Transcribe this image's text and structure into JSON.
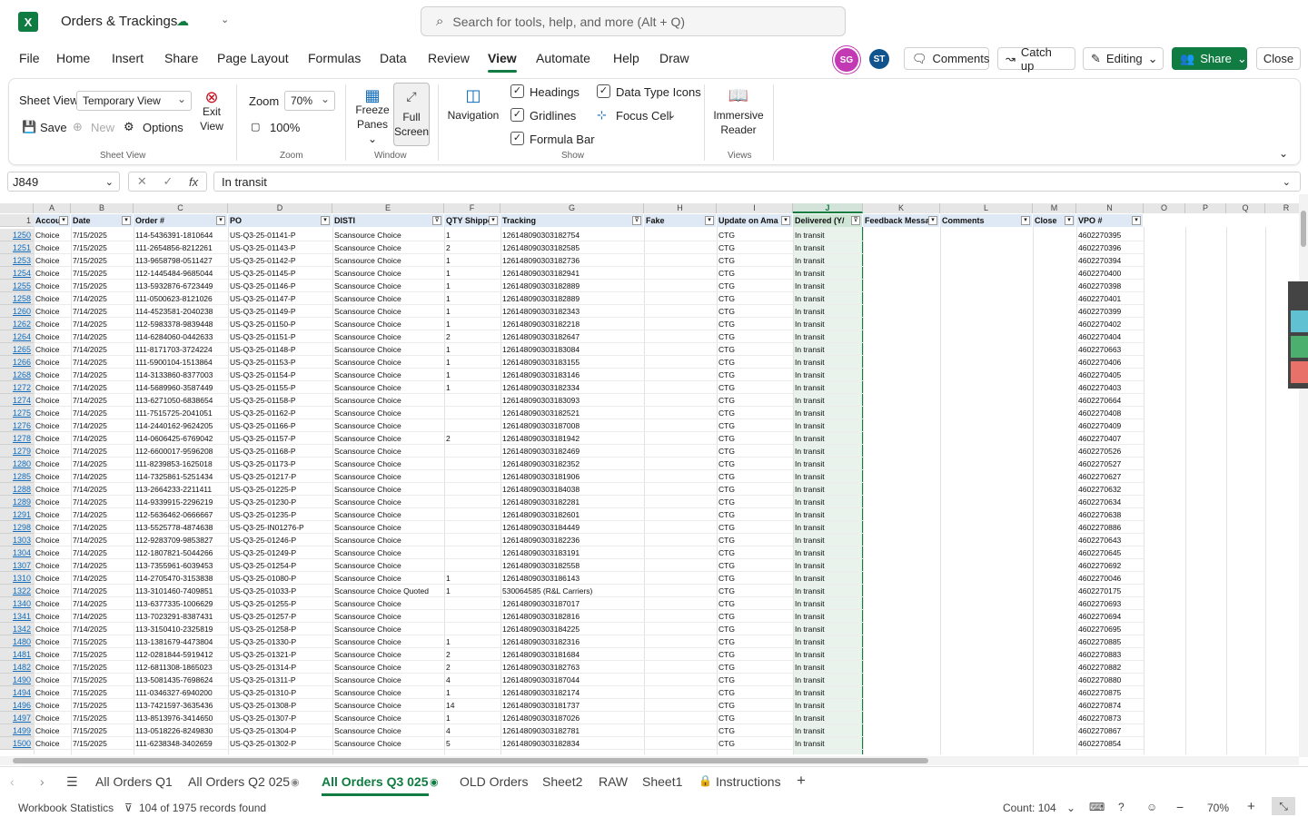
{
  "app": {
    "title": "Orders & Trackings",
    "logo_letter": "X"
  },
  "search": {
    "placeholder": "Search for tools, help, and more (Alt + Q)"
  },
  "menu": [
    "File",
    "Home",
    "Insert",
    "Share",
    "Page Layout",
    "Formulas",
    "Data",
    "Review",
    "View",
    "Automate",
    "Help",
    "Draw"
  ],
  "menu_active": "View",
  "users": [
    {
      "initials": "SG",
      "color": "#c239b3"
    },
    {
      "initials": "ST",
      "color": "#0f548c"
    }
  ],
  "buttons": {
    "comments": "Comments",
    "catchup": "Catch up",
    "editing": "Editing",
    "share": "Share",
    "close": "Close"
  },
  "ribbon": {
    "sheet_view_label": "Sheet View",
    "sheet_view_value": "Temporary View",
    "save": "Save",
    "new": "New",
    "options": "Options",
    "exit_view": "Exit\nView",
    "group_sheet_view": "Sheet View",
    "zoom_label": "Zoom",
    "zoom_value": "70%",
    "zoom_100": "100%",
    "group_zoom": "Zoom",
    "freeze_panes": "Freeze Panes",
    "full_screen": "Full Screen",
    "group_window": "Window",
    "navigation": "Navigation",
    "headings": "Headings",
    "gridlines": "Gridlines",
    "formula_bar": "Formula Bar",
    "data_type_icons": "Data Type Icons",
    "focus_cell": "Focus Cell",
    "group_show": "Show",
    "immersive_reader": "Immersive Reader",
    "group_views": "Views"
  },
  "formula": {
    "cell_ref": "J849",
    "value": "In transit"
  },
  "columns": [
    {
      "letter": "A",
      "header": "Accou"
    },
    {
      "letter": "B",
      "header": "Date"
    },
    {
      "letter": "C",
      "header": "Order #"
    },
    {
      "letter": "D",
      "header": "PO"
    },
    {
      "letter": "E",
      "header": "DISTI"
    },
    {
      "letter": "F",
      "header": "QTY Shippe"
    },
    {
      "letter": "G",
      "header": "Tracking"
    },
    {
      "letter": "H",
      "header": "Fake"
    },
    {
      "letter": "I",
      "header": "Update on Ama"
    },
    {
      "letter": "J",
      "header": "Delivered (Y/"
    },
    {
      "letter": "K",
      "header": "Feedback Messa"
    },
    {
      "letter": "L",
      "header": "Comments"
    },
    {
      "letter": "M",
      "header": "Close"
    },
    {
      "letter": "N",
      "header": "VPO #"
    },
    {
      "letter": "O",
      "header": ""
    },
    {
      "letter": "P",
      "header": ""
    },
    {
      "letter": "Q",
      "header": ""
    },
    {
      "letter": "R",
      "header": ""
    }
  ],
  "header_row_number": "1",
  "rows": [
    [
      "1250",
      "Choice",
      "7/15/2025",
      "114-5436391-1810644",
      "US-Q3-25-01141-P",
      "Scansource Choice",
      "1",
      "126148090303182754",
      "",
      "CTG",
      "In transit",
      "4602270395"
    ],
    [
      "1251",
      "Choice",
      "7/15/2025",
      "111-2654856-8212261",
      "US-Q3-25-01143-P",
      "Scansource Choice",
      "2",
      "126148090303182585",
      "",
      "CTG",
      "In transit",
      "4602270396"
    ],
    [
      "1253",
      "Choice",
      "7/15/2025",
      "113-9658798-0511427",
      "US-Q3-25-01142-P",
      "Scansource Choice",
      "1",
      "126148090303182736",
      "",
      "CTG",
      "In transit",
      "4602270394"
    ],
    [
      "1254",
      "Choice",
      "7/15/2025",
      "112-1445484-9685044",
      "US-Q3-25-01145-P",
      "Scansource Choice",
      "1",
      "126148090303182941",
      "",
      "CTG",
      "In transit",
      "4602270400"
    ],
    [
      "1255",
      "Choice",
      "7/15/2025",
      "113-5932876-6723449",
      "US-Q3-25-01146-P",
      "Scansource Choice",
      "1",
      "126148090303182889",
      "",
      "CTG",
      "In transit",
      "4602270398"
    ],
    [
      "1258",
      "Choice",
      "7/14/2025",
      "111-0500623-8121026",
      "US-Q3-25-01147-P",
      "Scansource Choice",
      "1",
      "126148090303182889",
      "",
      "CTG",
      "In transit",
      "4602270401"
    ],
    [
      "1260",
      "Choice",
      "7/14/2025",
      "114-4523581-2040238",
      "US-Q3-25-01149-P",
      "Scansource Choice",
      "1",
      "126148090303182343",
      "",
      "CTG",
      "In transit",
      "4602270399"
    ],
    [
      "1262",
      "Choice",
      "7/14/2025",
      "112-5983378-9839448",
      "US-Q3-25-01150-P",
      "Scansource Choice",
      "1",
      "126148090303182218",
      "",
      "CTG",
      "In transit",
      "4602270402"
    ],
    [
      "1264",
      "Choice",
      "7/14/2025",
      "114-6284060-0442633",
      "US-Q3-25-01151-P",
      "Scansource Choice",
      "2",
      "126148090303182647",
      "",
      "CTG",
      "In transit",
      "4602270404"
    ],
    [
      "1265",
      "Choice",
      "7/14/2025",
      "111-8171703-3724224",
      "US-Q3-25-01148-P",
      "Scansource Choice",
      "1",
      "126148090303183084",
      "",
      "CTG",
      "In transit",
      "4602270663"
    ],
    [
      "1266",
      "Choice",
      "7/14/2025",
      "111-5900104-1513864",
      "US-Q3-25-01153-P",
      "Scansource Choice",
      "1",
      "126148090303183155",
      "",
      "CTG",
      "In transit",
      "4602270406"
    ],
    [
      "1268",
      "Choice",
      "7/14/2025",
      "114-3133860-8377003",
      "US-Q3-25-01154-P",
      "Scansource Choice",
      "1",
      "126148090303183146",
      "",
      "CTG",
      "In transit",
      "4602270405"
    ],
    [
      "1272",
      "Choice",
      "7/14/2025",
      "114-5689960-3587449",
      "US-Q3-25-01155-P",
      "Scansource Choice",
      "1",
      "126148090303182334",
      "",
      "CTG",
      "In transit",
      "4602270403"
    ],
    [
      "1274",
      "Choice",
      "7/14/2025",
      "113-6271050-6838654",
      "US-Q3-25-01158-P",
      "Scansource Choice",
      "",
      "126148090303183093",
      "",
      "CTG",
      "In transit",
      "4602270664"
    ],
    [
      "1275",
      "Choice",
      "7/14/2025",
      "111-7515725-2041051",
      "US-Q3-25-01162-P",
      "Scansource Choice",
      "",
      "126148090303182521",
      "",
      "CTG",
      "In transit",
      "4602270408"
    ],
    [
      "1276",
      "Choice",
      "7/14/2025",
      "114-2440162-9624205",
      "US-Q3-25-01166-P",
      "Scansource Choice",
      "",
      "126148090303187008",
      "",
      "CTG",
      "In transit",
      "4602270409"
    ],
    [
      "1278",
      "Choice",
      "7/14/2025",
      "114-0606425-6769042",
      "US-Q3-25-01157-P",
      "Scansource Choice",
      "2",
      "126148090303181942",
      "",
      "CTG",
      "In transit",
      "4602270407"
    ],
    [
      "1279",
      "Choice",
      "7/14/2025",
      "112-6600017-9596208",
      "US-Q3-25-01168-P",
      "Scansource Choice",
      "",
      "126148090303182469",
      "",
      "CTG",
      "In transit",
      "4602270526"
    ],
    [
      "1280",
      "Choice",
      "7/14/2025",
      "111-8239853-1625018",
      "US-Q3-25-01173-P",
      "Scansource Choice",
      "",
      "126148090303182352",
      "",
      "CTG",
      "In transit",
      "4602270527"
    ],
    [
      "1285",
      "Choice",
      "7/14/2025",
      "114-7325861-5251434",
      "US-Q3-25-01217-P",
      "Scansource Choice",
      "",
      "126148090303181906",
      "",
      "CTG",
      "In transit",
      "4602270627"
    ],
    [
      "1288",
      "Choice",
      "7/14/2025",
      "113-2664233-2211411",
      "US-Q3-25-01225-P",
      "Scansource Choice",
      "",
      "126148090303184038",
      "",
      "CTG",
      "In transit",
      "4602270632"
    ],
    [
      "1289",
      "Choice",
      "7/14/2025",
      "114-9339915-2296219",
      "US-Q3-25-01230-P",
      "Scansource Choice",
      "",
      "126148090303182281",
      "",
      "CTG",
      "In transit",
      "4602270634"
    ],
    [
      "1291",
      "Choice",
      "7/14/2025",
      "112-5636462-0666667",
      "US-Q3-25-01235-P",
      "Scansource Choice",
      "",
      "126148090303182601",
      "",
      "CTG",
      "In transit",
      "4602270638"
    ],
    [
      "1298",
      "Choice",
      "7/14/2025",
      "113-5525778-4874638",
      "US-Q3-25-IN01276-P",
      "Scansource Choice",
      "",
      "126148090303184449",
      "",
      "CTG",
      "In transit",
      "4602270886"
    ],
    [
      "1303",
      "Choice",
      "7/14/2025",
      "112-9283709-9853827",
      "US-Q3-25-01246-P",
      "Scansource Choice",
      "",
      "126148090303182236",
      "",
      "CTG",
      "In transit",
      "4602270643"
    ],
    [
      "1304",
      "Choice",
      "7/14/2025",
      "112-1807821-5044266",
      "US-Q3-25-01249-P",
      "Scansource Choice",
      "",
      "126148090303183191",
      "",
      "CTG",
      "In transit",
      "4602270645"
    ],
    [
      "1307",
      "Choice",
      "7/14/2025",
      "113-7355961-6039453",
      "US-Q3-25-01254-P",
      "Scansource Choice",
      "",
      "126148090303182558",
      "",
      "CTG",
      "In transit",
      "4602270692"
    ],
    [
      "1310",
      "Choice",
      "7/14/2025",
      "114-2705470-3153838",
      "US-Q3-25-01080-P",
      "Scansource Choice",
      "1",
      "126148090303186143",
      "",
      "CTG",
      "In transit",
      "4602270046"
    ],
    [
      "1322",
      "Choice",
      "7/14/2025",
      "113-3101460-7409851",
      "US-Q3-25-01033-P",
      "Scansource Choice Quoted",
      "1",
      "530064585 (R&L Carriers)",
      "",
      "CTG",
      "In transit",
      "4602270175"
    ],
    [
      "1340",
      "Choice",
      "7/14/2025",
      "113-6377335-1006629",
      "US-Q3-25-01255-P",
      "Scansource Choice",
      "",
      "126148090303187017",
      "",
      "CTG",
      "In transit",
      "4602270693"
    ],
    [
      "1341",
      "Choice",
      "7/14/2025",
      "113-7023291-8387431",
      "US-Q3-25-01257-P",
      "Scansource Choice",
      "",
      "126148090303182816",
      "",
      "CTG",
      "In transit",
      "4602270694"
    ],
    [
      "1342",
      "Choice",
      "7/14/2025",
      "113-3150410-2325819",
      "US-Q3-25-01258-P",
      "Scansource Choice",
      "",
      "126148090303184225",
      "",
      "CTG",
      "In transit",
      "4602270695"
    ],
    [
      "1480",
      "Choice",
      "7/15/2025",
      "113-1381679-4473804",
      "US-Q3-25-01330-P",
      "Scansource Choice",
      "1",
      "126148090303182316",
      "",
      "CTG",
      "In transit",
      "4602270885"
    ],
    [
      "1481",
      "Choice",
      "7/15/2025",
      "112-0281844-5919412",
      "US-Q3-25-01321-P",
      "Scansource Choice",
      "2",
      "126148090303181684",
      "",
      "CTG",
      "In transit",
      "4602270883"
    ],
    [
      "1482",
      "Choice",
      "7/15/2025",
      "112-6811308-1865023",
      "US-Q3-25-01314-P",
      "Scansource Choice",
      "2",
      "126148090303182763",
      "",
      "CTG",
      "In transit",
      "4602270882"
    ],
    [
      "1490",
      "Choice",
      "7/15/2025",
      "113-5081435-7698624",
      "US-Q3-25-01311-P",
      "Scansource Choice",
      "4",
      "126148090303187044",
      "",
      "CTG",
      "In transit",
      "4602270880"
    ],
    [
      "1494",
      "Choice",
      "7/15/2025",
      "111-0346327-6940200",
      "US-Q3-25-01310-P",
      "Scansource Choice",
      "1",
      "126148090303182174",
      "",
      "CTG",
      "In transit",
      "4602270875"
    ],
    [
      "1496",
      "Choice",
      "7/15/2025",
      "113-7421597-3635436",
      "US-Q3-25-01308-P",
      "Scansource Choice",
      "14",
      "126148090303181737",
      "",
      "CTG",
      "In transit",
      "4602270874"
    ],
    [
      "1497",
      "Choice",
      "7/15/2025",
      "113-8513976-3414650",
      "US-Q3-25-01307-P",
      "Scansource Choice",
      "1",
      "126148090303187026",
      "",
      "CTG",
      "In transit",
      "4602270873"
    ],
    [
      "1499",
      "Choice",
      "7/15/2025",
      "113-0518226-8249830",
      "US-Q3-25-01304-P",
      "Scansource Choice",
      "4",
      "126148090303182781",
      "",
      "CTG",
      "In transit",
      "4602270867"
    ],
    [
      "1500",
      "Choice",
      "7/15/2025",
      "111-6238348-3402659",
      "US-Q3-25-01302-P",
      "Scansource Choice",
      "5",
      "126148090303182834",
      "",
      "CTG",
      "In transit",
      "4602270854"
    ]
  ],
  "sheets": [
    "All Orders Q1",
    "All Orders Q2 025",
    "All Orders Q3 025",
    "OLD Orders",
    "Sheet2",
    "RAW",
    "Sheet1",
    "Instructions"
  ],
  "active_sheet": "All Orders Q3 025",
  "status": {
    "workbook_stats": "Workbook Statistics",
    "filter": "104 of 1975 records found",
    "count": "Count: 104",
    "zoom": "70%"
  },
  "colors": {
    "accent": "#107c41",
    "selected_col": "#d3e3d9",
    "header_fill": "#dfe9f5",
    "link": "#0f6cbd"
  }
}
